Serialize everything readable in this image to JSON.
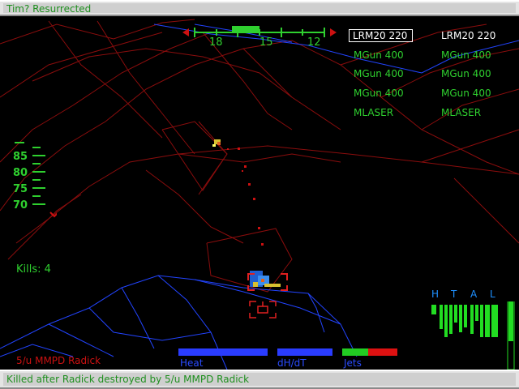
{
  "top_status": "Tim? Resurrected",
  "bottom_status": "Killed after Radick destroyed by 5/u MMPD Radick",
  "compass": {
    "ticks": [
      "18",
      "15",
      "12"
    ]
  },
  "weapons": {
    "left": [
      "LRM20 220",
      "MGun 400",
      "MGun 400",
      "MGun 400",
      "MLASER"
    ],
    "right": [
      "LRM20 220",
      "MGun 400",
      "MGun 400",
      "MGun 400",
      "MLASER"
    ]
  },
  "speed_scale": [
    "85",
    "80",
    "75",
    "70"
  ],
  "kills": "Kills: 4",
  "target_name": "5/u MMPD Radick",
  "gauges": {
    "heat": "Heat",
    "dhdt": "dH/dT",
    "jets": "Jets"
  },
  "htal": [
    "H",
    "T",
    "A",
    "L"
  ],
  "colors": {
    "hud_green": "#2fd02f",
    "wire_red": "#8b0d0d",
    "wire_blue": "#2244ff",
    "alert_red": "#cc1111"
  }
}
